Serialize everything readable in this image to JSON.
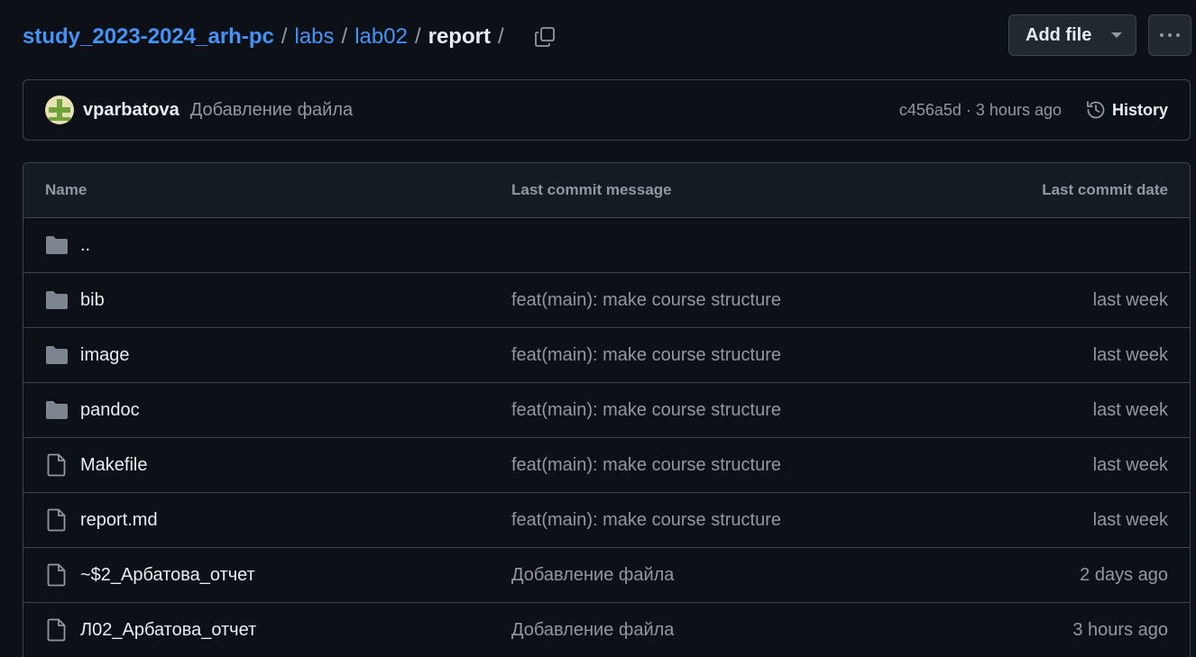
{
  "breadcrumb": {
    "repo": "study_2023-2024_arh-pc",
    "folders": [
      "labs",
      "lab02"
    ],
    "current": "report",
    "separator": "/",
    "trailing_separator": "/"
  },
  "toolbar": {
    "add_file_label": "Add file",
    "copy_path_icon": "copy-icon",
    "more_icon": "kebab-horizontal-icon"
  },
  "latest_commit": {
    "author": "vparbatova",
    "message": "Добавление файла",
    "sha": "c456a5d",
    "meta_separator": " · ",
    "time": "3 hours ago",
    "history_label": "History"
  },
  "table": {
    "headers": {
      "name": "Name",
      "message": "Last commit message",
      "date": "Last commit date"
    },
    "parent_dir": "..",
    "rows": [
      {
        "name": "bib",
        "type": "folder",
        "message": "feat(main): make course structure",
        "date": "last week"
      },
      {
        "name": "image",
        "type": "folder",
        "message": "feat(main): make course structure",
        "date": "last week"
      },
      {
        "name": "pandoc",
        "type": "folder",
        "message": "feat(main): make course structure",
        "date": "last week"
      },
      {
        "name": "Makefile",
        "type": "file",
        "message": "feat(main): make course structure",
        "date": "last week"
      },
      {
        "name": "report.md",
        "type": "file",
        "message": "feat(main): make course structure",
        "date": "last week"
      },
      {
        "name": "~$2_Арбатова_отчет",
        "type": "file",
        "message": "Добавление файла",
        "date": "2 days ago"
      },
      {
        "name": "Л02_Арбатова_отчет",
        "type": "file",
        "message": "Добавление файла",
        "date": "3 hours ago"
      }
    ]
  },
  "colors": {
    "background": "#0d1117",
    "link": "#4493f8",
    "muted": "#9198a1",
    "border": "#3d444d",
    "folder_icon": "#7d8590"
  }
}
